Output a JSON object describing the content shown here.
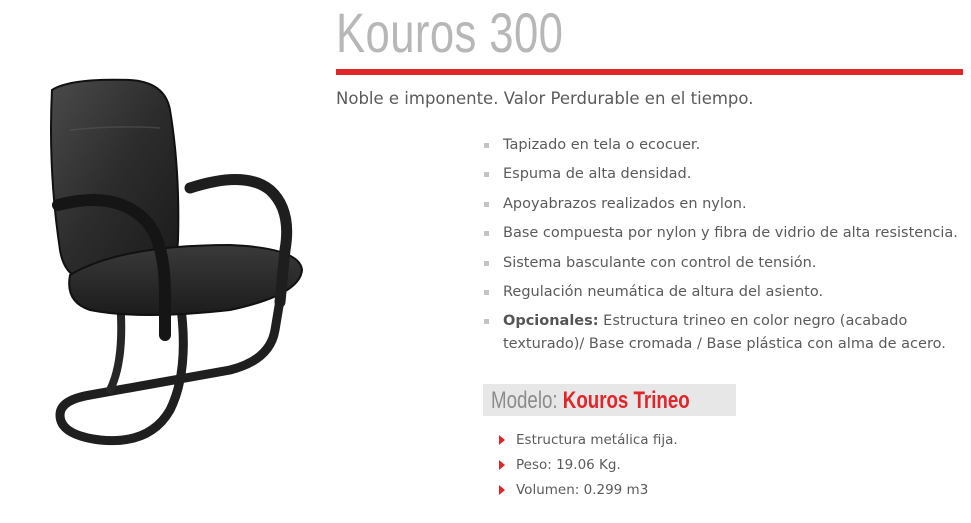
{
  "product": {
    "title": "Kouros 300",
    "tagline": "Noble e imponente. Valor Perdurable en el tiempo.",
    "features": [
      "Tapizado en tela o ecocuer.",
      "Espuma de alta densidad.",
      "Apoyabrazos realizados en nylon.",
      "Base compuesta por nylon y fibra de vidrio de alta resistencia.",
      "Sistema basculante con control de tensión.",
      "Regulación neumática de altura del asiento."
    ],
    "optional_label": "Opcionales:",
    "optional_text": " Estructura trineo en color negro (acabado texturado)/ Base cromada / Base plástica con alma de acero.",
    "model_label": "Modelo:",
    "model_name": "Kouros Trineo",
    "specs": [
      "Estructura metálica fija.",
      "Peso: 19.06 Kg.",
      "Volumen: 0.299 m3"
    ]
  },
  "colors": {
    "accent": "#e0262b",
    "title": "#b7b7b7",
    "text": "#5b5b5b",
    "model_box": "#e7e7e7"
  },
  "icons": {
    "feature_bullet": "square-bullet-icon",
    "spec_bullet": "arrow-right-icon",
    "product": "office-chair-image"
  }
}
